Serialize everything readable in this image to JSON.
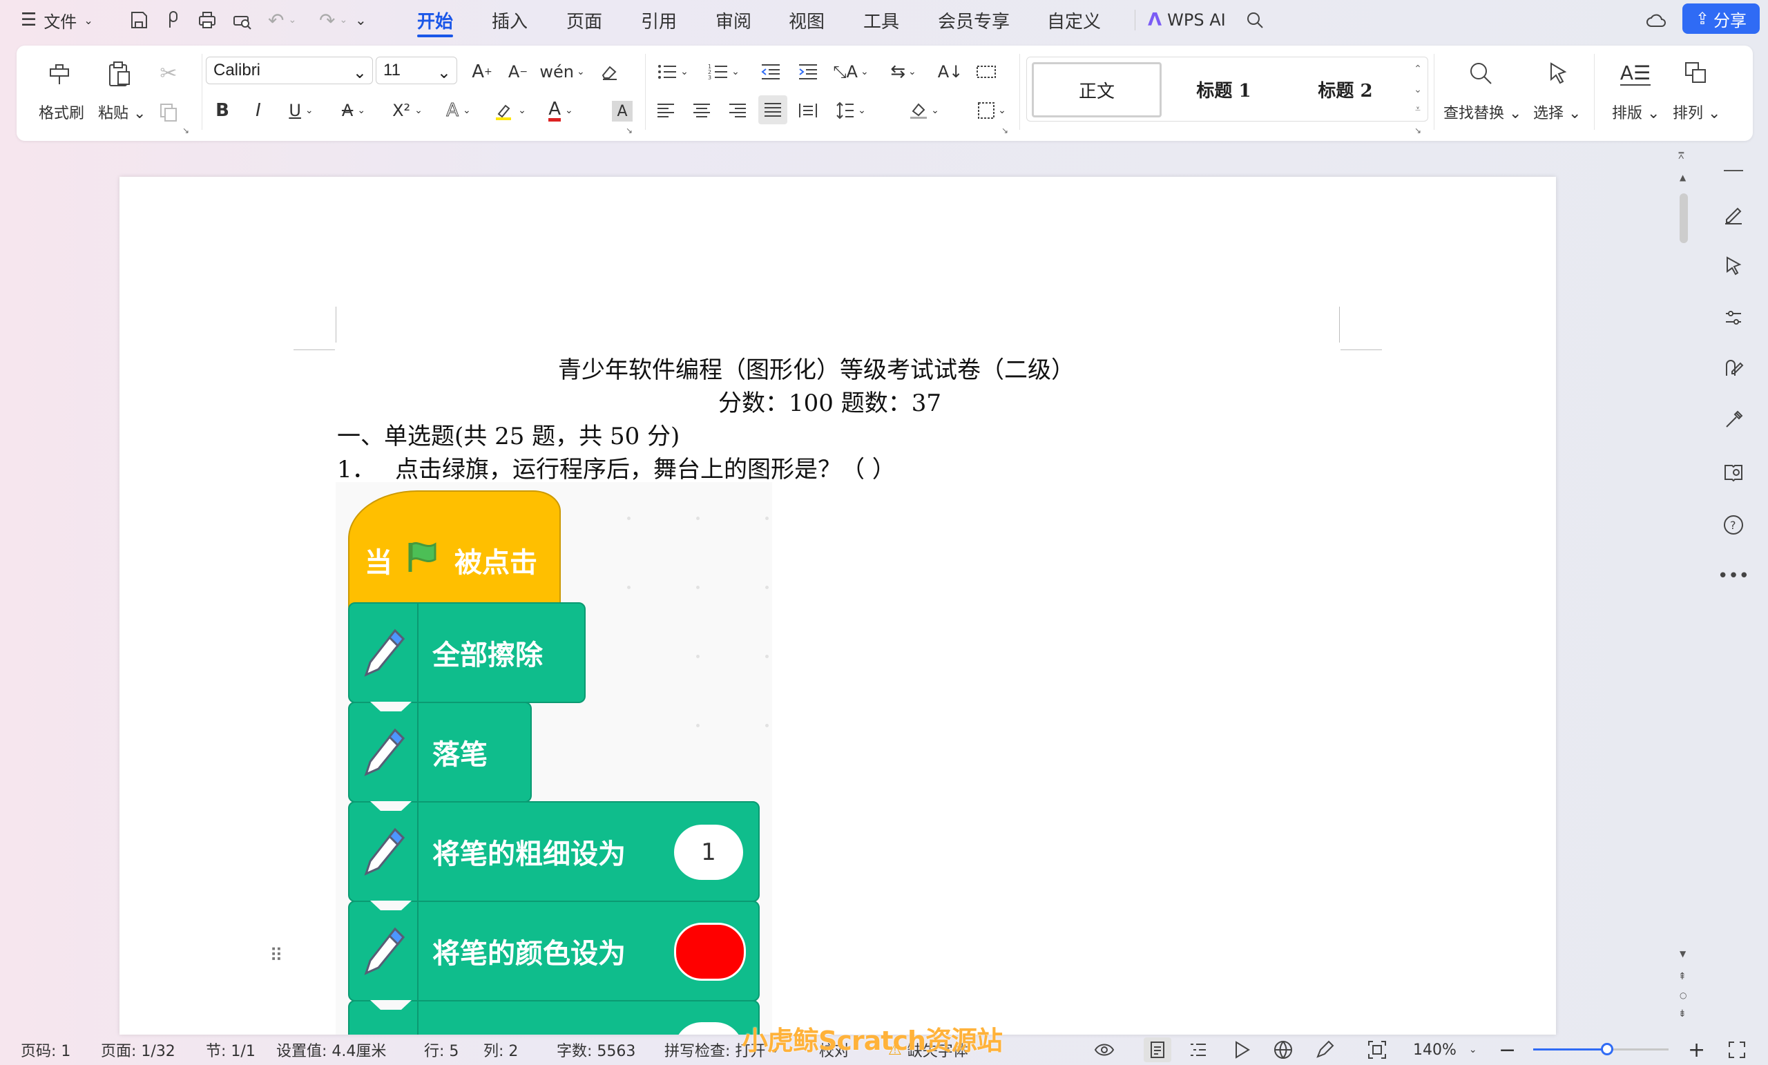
{
  "menu": {
    "file_label": "文件",
    "tabs": [
      "开始",
      "插入",
      "页面",
      "引用",
      "审阅",
      "视图",
      "工具",
      "会员专享",
      "自定义"
    ],
    "active_tab": "开始",
    "ai_label": "WPS AI",
    "share_label": "分享"
  },
  "ribbon": {
    "format_painter": "格式刷",
    "paste": "粘贴",
    "font_name": "Calibri",
    "font_size": "11",
    "styles": [
      "正文",
      "标题 1",
      "标题 2"
    ],
    "find_replace": "查找替换",
    "select": "选择",
    "layout": "排版",
    "arrange": "排列"
  },
  "document": {
    "title": "青少年软件编程（图形化）等级考试试卷（二级）",
    "score_line": "分数：100  题数：37",
    "section": "一、单选题(共 25 题，共 50 分)",
    "question_number": "1．",
    "question_text": "点击绿旗，运行程序后，舞台上的图形是？（ ）"
  },
  "scratch": {
    "hat_when": "当",
    "hat_clicked": "被点击",
    "blocks": [
      "全部擦除",
      "落笔",
      "将笔的粗细设为",
      "将笔的颜色设为"
    ],
    "pen_size_value": "1",
    "pen_color": "#ff0000"
  },
  "status": {
    "page_number": "页码: 1",
    "pages": "页面: 1/32",
    "section": "节: 1/1",
    "setting": "设置值: 4.4厘米",
    "row": "行: 5",
    "col": "列: 2",
    "word_count": "字数: 5563",
    "spell_check": "拼写检查: 打开",
    "proofread": "校对",
    "missing_font": "缺失字体",
    "zoom": "140%"
  },
  "watermark": "小虎鲸Scratch资源站",
  "colors": {
    "accent": "#1a56e8",
    "scratch_green": "#0fbd8c",
    "scratch_yellow": "#ffbf00"
  }
}
